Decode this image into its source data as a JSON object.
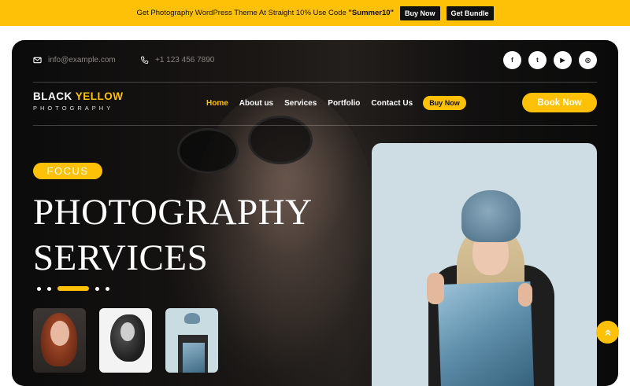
{
  "promo": {
    "text_prefix": "Get Photography WordPress Theme At Straight 10% Use Code ",
    "code": "\"Summer10\"",
    "buy_now_label": "Buy Now",
    "get_bundle_label": "Get Bundle"
  },
  "topbar": {
    "email": "info@example.com",
    "phone": "+1 123 456 7890",
    "social": [
      {
        "icon": "facebook-icon",
        "glyph": "f"
      },
      {
        "icon": "twitter-icon",
        "glyph": "t"
      },
      {
        "icon": "youtube-icon",
        "glyph": "▶"
      },
      {
        "icon": "instagram-icon",
        "glyph": "◎"
      }
    ]
  },
  "logo": {
    "word1": "BLACK ",
    "word2": "YELLOW",
    "subtitle": "PHOTOGRAPHY"
  },
  "nav": {
    "items": [
      {
        "label": "Home",
        "active": true
      },
      {
        "label": "About us"
      },
      {
        "label": "Services"
      },
      {
        "label": "Portfolio"
      },
      {
        "label": "Contact Us"
      }
    ],
    "cta_label": "Buy Now",
    "book_label": "Book Now"
  },
  "hero": {
    "badge": "FOCUS",
    "headline_line1": "PHOTOGRAPHY",
    "headline_line2": "SERVICES"
  },
  "colors": {
    "accent": "#ffc107",
    "dark": "#111111"
  }
}
